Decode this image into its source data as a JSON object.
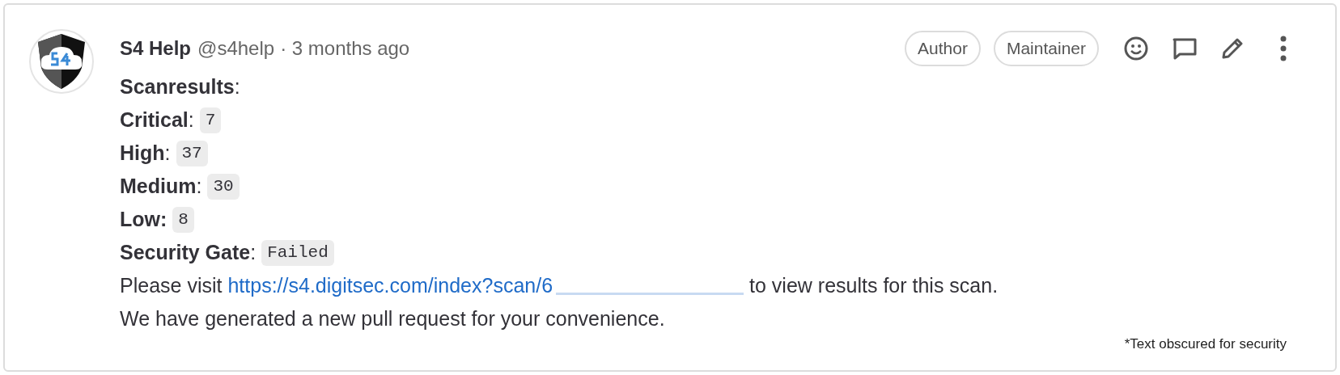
{
  "comment": {
    "author": "S4 Help",
    "handle": "@s4help",
    "time": "· 3 months ago",
    "badges": [
      "Author",
      "Maintainer"
    ],
    "lines": [
      {
        "label": "**Scanresults**:"
      },
      {
        "label": "**Critical**:",
        "value": "7"
      },
      {
        "label": "**High**:",
        "value": "37"
      },
      {
        "label": "**Medium**:",
        "value": "30"
      },
      {
        "label": "**Low:**",
        "value": "8"
      },
      {
        "label": "**Security Gate**:",
        "value": "Failed"
      }
    ],
    "visit": {
      "before": "Please visit",
      "link": "https://s4.digitsec.com/index?scan/6",
      "after": "to view results for this scan."
    },
    "closing": "We have generated a new pull request for your convenience.",
    "footnote": "*Text obscured for security"
  }
}
